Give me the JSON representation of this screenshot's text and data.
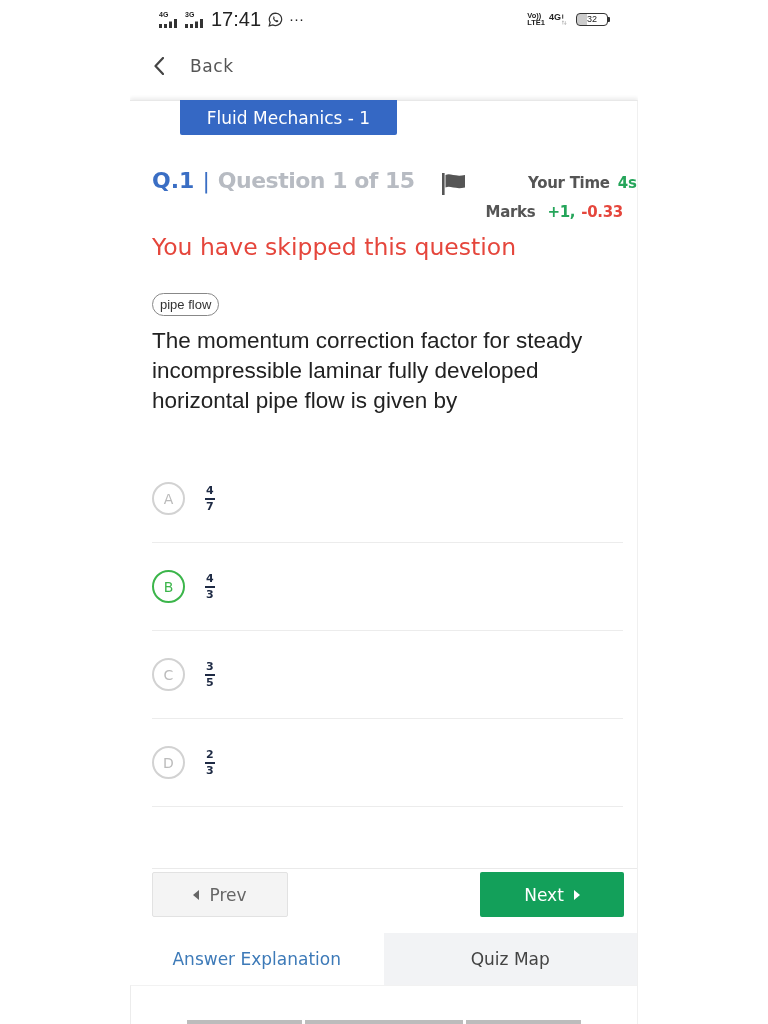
{
  "status_bar": {
    "network_1": "4G",
    "network_2": "3G",
    "time": "17:41",
    "more": "···",
    "volte": "Vo))",
    "lte": "LTE1",
    "network_3": "4G",
    "battery": "32"
  },
  "header": {
    "back": "Back"
  },
  "quiz": {
    "subject": "Fluid Mechanics - 1",
    "question_number": "Q.1",
    "separator": "|",
    "question_count": "Question 1 of 15",
    "time_label": "Your Time",
    "time_value": "4s",
    "marks_label": "Marks",
    "marks_positive": "+1,",
    "marks_negative": "-0.33",
    "status": "You have skipped this question",
    "tag": "pipe flow",
    "question": "The momentum correction factor for steady incompressible laminar fully developed horizontal pipe flow is given by"
  },
  "options": [
    {
      "letter": "A",
      "numerator": "4",
      "denominator": "7",
      "correct": false
    },
    {
      "letter": "B",
      "numerator": "4",
      "denominator": "3",
      "correct": true
    },
    {
      "letter": "C",
      "numerator": "3",
      "denominator": "5",
      "correct": false
    },
    {
      "letter": "D",
      "numerator": "2",
      "denominator": "3",
      "correct": false
    }
  ],
  "navigation": {
    "prev": "Prev",
    "next": "Next"
  },
  "tabs": [
    {
      "label": "Answer Explanation",
      "selected": true
    },
    {
      "label": "Quiz Map",
      "selected": false
    }
  ]
}
